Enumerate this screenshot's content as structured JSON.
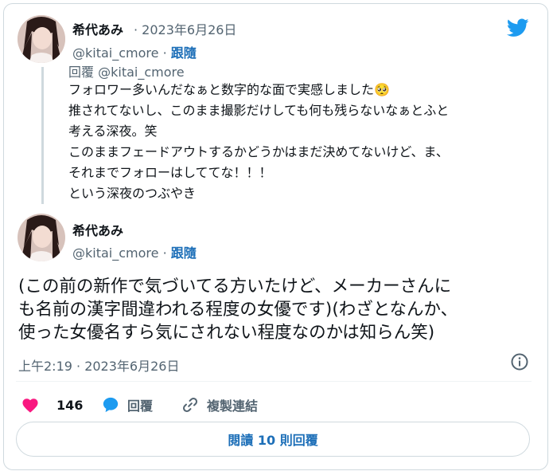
{
  "quoted_tweet": {
    "author_name": "希代あみ",
    "timestamp": "· 2023年6月26日",
    "handle": "@kitai_cmore ·",
    "follow_label": "跟隨",
    "reply_prefix": "回覆",
    "reply_handle": "@kitai_cmore",
    "text_lines": [
      "フォロワー多いんだなぁと数字的な面で実感しました🥺",
      "推されてないし、このまま撮影だけしても何も残らないなぁとふと",
      "考える深夜。笑",
      "このままフェードアウトするかどうかはまだ決めてないけど、ま、",
      "それまでフォローはしててな！！！",
      "という深夜のつぶやき"
    ]
  },
  "main_tweet": {
    "author_name": "希代あみ",
    "handle": "@kitai_cmore ·",
    "follow_label": "跟隨",
    "text_lines": [
      "(この前の新作で気づいてる方いたけど、メーカーさんに",
      "も名前の漢字間違われる程度の女優です)(わざとなんか、",
      "使った女優名すら気にされない程度なのかは知らん笑)"
    ],
    "timestamp": "上午2:19 · 2023年6月26日"
  },
  "actions": {
    "like_count": "146",
    "reply_label": "回覆",
    "copy_link_label": "複製連結"
  },
  "read_replies_label": "閱讀 10 則回覆",
  "icons": {
    "brand": "twitter-bird-icon",
    "info": "info-icon",
    "like": "heart-icon",
    "reply": "speech-bubble-icon",
    "copy": "link-icon"
  },
  "colors": {
    "twitter_blue": "#1d9bf0",
    "like_pink": "#f91880",
    "link_blue": "#1d6fb8",
    "gray_text": "#536471",
    "border": "#cfd9de"
  }
}
